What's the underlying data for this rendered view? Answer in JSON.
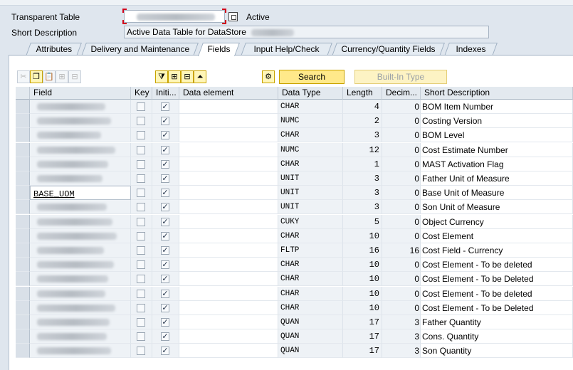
{
  "header": {
    "table_type_label": "Transparent Table",
    "status": "Active",
    "short_desc_label": "Short Description",
    "short_desc_value": "Active Data Table for DataStore"
  },
  "tabs": [
    {
      "label": "Attributes",
      "active": false
    },
    {
      "label": "Delivery and Maintenance",
      "active": false
    },
    {
      "label": "Fields",
      "active": true
    },
    {
      "label": "Input Help/Check",
      "active": false
    },
    {
      "label": "Currency/Quantity Fields",
      "active": false
    },
    {
      "label": "Indexes",
      "active": false
    }
  ],
  "toolbar": {
    "tools": [
      {
        "name": "cut-icon",
        "glyph": "✂",
        "enabled": false
      },
      {
        "name": "copy-icon",
        "glyph": "❐",
        "enabled": true
      },
      {
        "name": "paste-icon",
        "glyph": "📋",
        "enabled": false
      },
      {
        "name": "insert-row-icon",
        "glyph": "⊞",
        "enabled": false
      },
      {
        "name": "delete-row-icon",
        "glyph": "⊟",
        "enabled": false
      },
      {
        "name": "filter-icon",
        "glyph": "⧩",
        "enabled": true
      },
      {
        "name": "expand-icon",
        "glyph": "⊞",
        "enabled": true
      },
      {
        "name": "collapse-icon",
        "glyph": "⊟",
        "enabled": true
      },
      {
        "name": "sort-icon",
        "glyph": "⏶",
        "enabled": true
      },
      {
        "name": "where-used-icon",
        "glyph": "⚙",
        "enabled": true
      }
    ],
    "search_label": "Search",
    "builtin_label": "Built-In Type"
  },
  "columns": [
    "Field",
    "Key",
    "Initi...",
    "Data element",
    "Data Type",
    "Length",
    "Decim...",
    "Short Description"
  ],
  "rows": [
    {
      "field": "",
      "key": false,
      "init": true,
      "data_element": "",
      "data_type": "CHAR",
      "length": "4",
      "decimals": "0",
      "desc": "BOM Item Number"
    },
    {
      "field": "",
      "key": false,
      "init": true,
      "data_element": "",
      "data_type": "NUMC",
      "length": "2",
      "decimals": "0",
      "desc": "Costing Version"
    },
    {
      "field": "",
      "key": false,
      "init": true,
      "data_element": "",
      "data_type": "CHAR",
      "length": "3",
      "decimals": "0",
      "desc": "BOM Level"
    },
    {
      "field": "",
      "key": false,
      "init": true,
      "data_element": "",
      "data_type": "NUMC",
      "length": "12",
      "decimals": "0",
      "desc": "Cost Estimate Number"
    },
    {
      "field": "",
      "key": false,
      "init": true,
      "data_element": "",
      "data_type": "CHAR",
      "length": "1",
      "decimals": "0",
      "desc": "MAST Activation Flag"
    },
    {
      "field": "",
      "key": false,
      "init": true,
      "data_element": "",
      "data_type": "UNIT",
      "length": "3",
      "decimals": "0",
      "desc": "Father Unit of Measure"
    },
    {
      "field": "BASE_UOM",
      "key": false,
      "init": true,
      "data_element": "",
      "data_type": "UNIT",
      "length": "3",
      "decimals": "0",
      "desc": "Base Unit of Measure"
    },
    {
      "field": "",
      "key": false,
      "init": true,
      "data_element": "",
      "data_type": "UNIT",
      "length": "3",
      "decimals": "0",
      "desc": "Son Unit of Measure"
    },
    {
      "field": "",
      "key": false,
      "init": true,
      "data_element": "",
      "data_type": "CUKY",
      "length": "5",
      "decimals": "0",
      "desc": "Object Currency"
    },
    {
      "field": "",
      "key": false,
      "init": true,
      "data_element": "",
      "data_type": "CHAR",
      "length": "10",
      "decimals": "0",
      "desc": "Cost Element"
    },
    {
      "field": "",
      "key": false,
      "init": true,
      "data_element": "",
      "data_type": "FLTP",
      "length": "16",
      "decimals": "16",
      "desc": "Cost Field - Currency"
    },
    {
      "field": "",
      "key": false,
      "init": true,
      "data_element": "",
      "data_type": "CHAR",
      "length": "10",
      "decimals": "0",
      "desc": "Cost Element - To be deleted"
    },
    {
      "field": "",
      "key": false,
      "init": true,
      "data_element": "",
      "data_type": "CHAR",
      "length": "10",
      "decimals": "0",
      "desc": "Cost Element - To be Deleted"
    },
    {
      "field": "",
      "key": false,
      "init": true,
      "data_element": "",
      "data_type": "CHAR",
      "length": "10",
      "decimals": "0",
      "desc": "Cost Element - To be deleted"
    },
    {
      "field": "",
      "key": false,
      "init": true,
      "data_element": "",
      "data_type": "CHAR",
      "length": "10",
      "decimals": "0",
      "desc": "Cost Element - To be Deleted"
    },
    {
      "field": "",
      "key": false,
      "init": true,
      "data_element": "",
      "data_type": "QUAN",
      "length": "17",
      "decimals": "3",
      "desc": "Father Quantity"
    },
    {
      "field": "",
      "key": false,
      "init": true,
      "data_element": "",
      "data_type": "QUAN",
      "length": "17",
      "decimals": "3",
      "desc": "Cons. Quantity"
    },
    {
      "field": "",
      "key": false,
      "init": true,
      "data_element": "",
      "data_type": "QUAN",
      "length": "17",
      "decimals": "3",
      "desc": "Son Quantity"
    }
  ]
}
